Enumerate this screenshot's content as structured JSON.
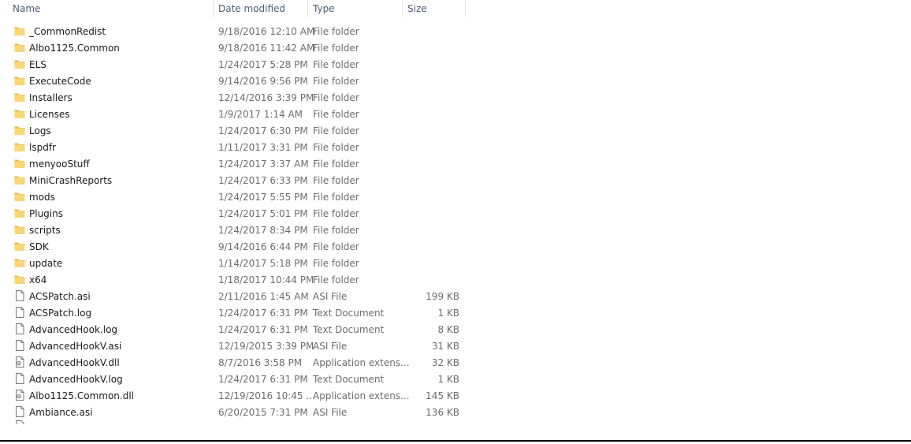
{
  "columns": {
    "name": "Name",
    "date": "Date modified",
    "type": "Type",
    "size": "Size"
  },
  "icons": {
    "folder": "folder-icon",
    "file": "file-icon",
    "dll": "dll-file-icon"
  },
  "colors": {
    "folder_fill": "#f8d775",
    "folder_shade": "#e8b84a",
    "header_text": "#4c607a",
    "meta_text": "#6d6d6d"
  },
  "rows": [
    {
      "name": "_CommonRedist",
      "date": "9/18/2016 12:10 AM",
      "type": "File folder",
      "size": "",
      "icon": "folder"
    },
    {
      "name": "Albo1125.Common",
      "date": "9/18/2016 11:42 AM",
      "type": "File folder",
      "size": "",
      "icon": "folder"
    },
    {
      "name": "ELS",
      "date": "1/24/2017 5:28 PM",
      "type": "File folder",
      "size": "",
      "icon": "folder"
    },
    {
      "name": "ExecuteCode",
      "date": "9/14/2016 9:56 PM",
      "type": "File folder",
      "size": "",
      "icon": "folder"
    },
    {
      "name": "Installers",
      "date": "12/14/2016 3:39 PM",
      "type": "File folder",
      "size": "",
      "icon": "folder"
    },
    {
      "name": "Licenses",
      "date": "1/9/2017 1:14 AM",
      "type": "File folder",
      "size": "",
      "icon": "folder"
    },
    {
      "name": "Logs",
      "date": "1/24/2017 6:30 PM",
      "type": "File folder",
      "size": "",
      "icon": "folder"
    },
    {
      "name": "lspdfr",
      "date": "1/11/2017 3:31 PM",
      "type": "File folder",
      "size": "",
      "icon": "folder"
    },
    {
      "name": "menyooStuff",
      "date": "1/24/2017 3:37 AM",
      "type": "File folder",
      "size": "",
      "icon": "folder"
    },
    {
      "name": "MiniCrashReports",
      "date": "1/24/2017 6:33 PM",
      "type": "File folder",
      "size": "",
      "icon": "folder"
    },
    {
      "name": "mods",
      "date": "1/24/2017 5:55 PM",
      "type": "File folder",
      "size": "",
      "icon": "folder"
    },
    {
      "name": "Plugins",
      "date": "1/24/2017 5:01 PM",
      "type": "File folder",
      "size": "",
      "icon": "folder"
    },
    {
      "name": "scripts",
      "date": "1/24/2017 8:34 PM",
      "type": "File folder",
      "size": "",
      "icon": "folder"
    },
    {
      "name": "SDK",
      "date": "9/14/2016 6:44 PM",
      "type": "File folder",
      "size": "",
      "icon": "folder"
    },
    {
      "name": "update",
      "date": "1/14/2017 5:18 PM",
      "type": "File folder",
      "size": "",
      "icon": "folder"
    },
    {
      "name": "x64",
      "date": "1/18/2017 10:44 PM",
      "type": "File folder",
      "size": "",
      "icon": "folder"
    },
    {
      "name": "ACSPatch.asi",
      "date": "2/11/2016 1:45 AM",
      "type": "ASI File",
      "size": "199 KB",
      "icon": "file"
    },
    {
      "name": "ACSPatch.log",
      "date": "1/24/2017 6:31 PM",
      "type": "Text Document",
      "size": "1 KB",
      "icon": "file"
    },
    {
      "name": "AdvancedHook.log",
      "date": "1/24/2017 6:31 PM",
      "type": "Text Document",
      "size": "8 KB",
      "icon": "file"
    },
    {
      "name": "AdvancedHookV.asi",
      "date": "12/19/2015 3:39 PM",
      "type": "ASI File",
      "size": "31 KB",
      "icon": "file"
    },
    {
      "name": "AdvancedHookV.dll",
      "date": "8/7/2016 3:58 PM",
      "type": "Application extens...",
      "size": "32 KB",
      "icon": "dll"
    },
    {
      "name": "AdvancedHookV.log",
      "date": "1/24/2017 6:31 PM",
      "type": "Text Document",
      "size": "1 KB",
      "icon": "file"
    },
    {
      "name": "Albo1125.Common.dll",
      "date": "12/19/2016 10:45 ...",
      "type": "Application extens...",
      "size": "145 KB",
      "icon": "dll"
    },
    {
      "name": "Ambiance.asi",
      "date": "6/20/2015 7:31 PM",
      "type": "ASI File",
      "size": "136 KB",
      "icon": "file"
    }
  ]
}
